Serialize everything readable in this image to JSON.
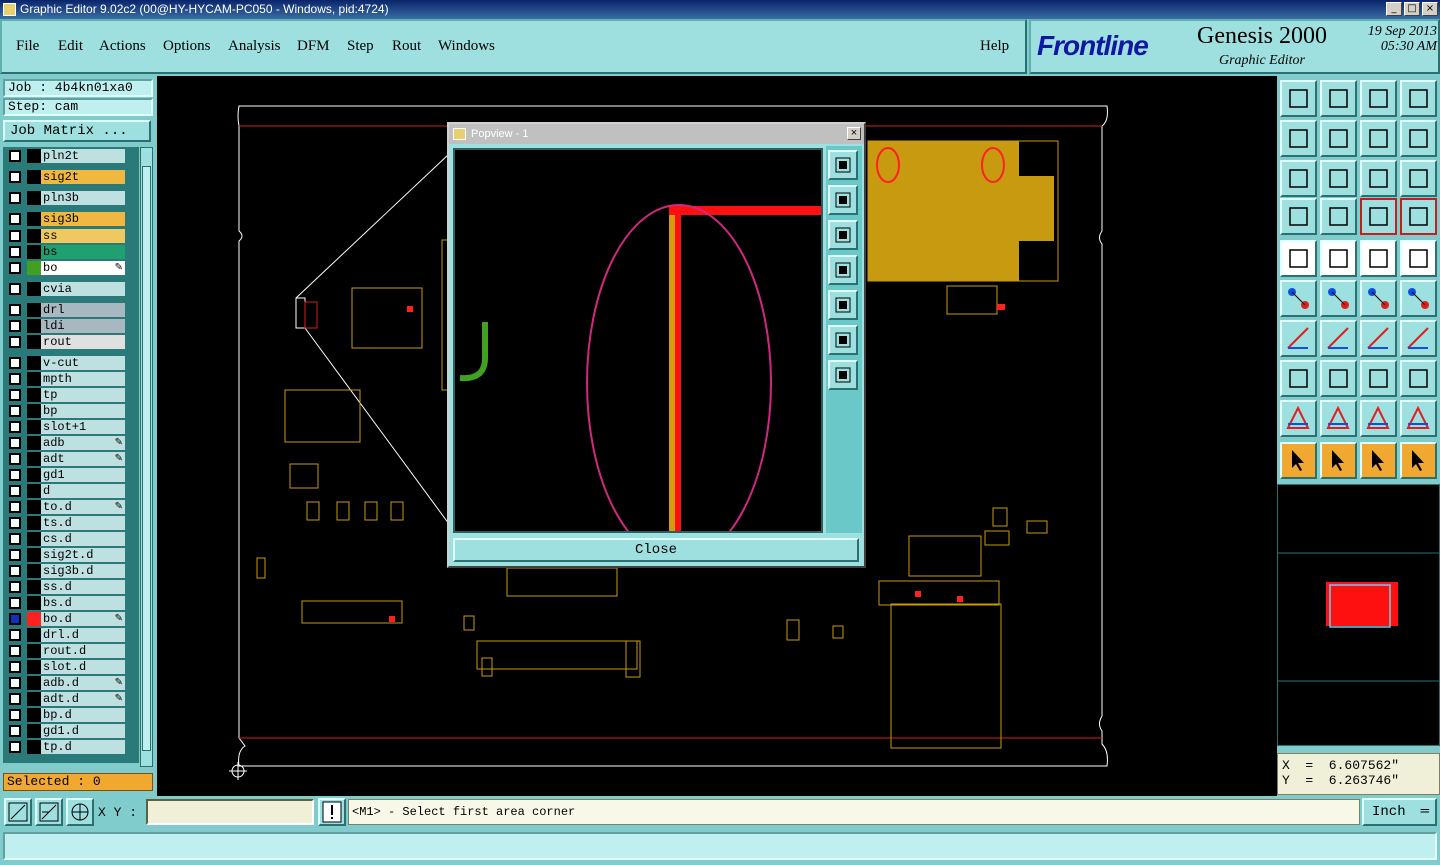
{
  "window": {
    "title": "Graphic Editor 9.02c2 (00@HY-HYCAM-PC050 - Windows, pid:4724)"
  },
  "menu": {
    "items": [
      "File",
      "Edit",
      "Actions",
      "Options",
      "Analysis",
      "DFM",
      "Step",
      "Rout",
      "Windows"
    ],
    "help": "Help"
  },
  "brand": {
    "logo": "Frontline",
    "product": "Genesis 2000",
    "subtitle": "Graphic Editor",
    "date": "19  Sep  2013",
    "time": "05:30  AM"
  },
  "job": {
    "job_label": "Job : 4b4kn01xa0",
    "step_label": "Step: cam",
    "matrix_button": "Job Matrix ..."
  },
  "layers": [
    {
      "name": "pln2t",
      "color": "#bfe0e0",
      "swatch": "#000000"
    },
    {
      "name": "sig2t",
      "color": "#f0b840",
      "swatch": "#000000"
    },
    {
      "name": "pln3b",
      "color": "#bfe0e0",
      "swatch": "#000000"
    },
    {
      "name": "sig3b",
      "color": "#f0b840",
      "swatch": "#000000"
    },
    {
      "name": "ss",
      "color": "#f0c860",
      "swatch": "#000000"
    },
    {
      "name": "bs",
      "color": "#20a070",
      "swatch": "#000000"
    },
    {
      "name": "bo",
      "color": "#ffffff",
      "swatch": "#40a020",
      "edit": true
    },
    {
      "name": "cvia",
      "color": "#bfe0e0",
      "swatch": "#000000"
    },
    {
      "name": "drl",
      "color": "#a8b8c0",
      "swatch": "#000000"
    },
    {
      "name": "ldi",
      "color": "#a8b8c0",
      "swatch": "#000000"
    },
    {
      "name": "rout",
      "color": "#e0e0e0",
      "swatch": "#000000"
    },
    {
      "name": "v-cut",
      "color": "#bfe0e0",
      "swatch": "#000000"
    },
    {
      "name": "mpth",
      "color": "#bfe0e0",
      "swatch": "#000000"
    },
    {
      "name": "tp",
      "color": "#bfe0e0",
      "swatch": "#000000"
    },
    {
      "name": "bp",
      "color": "#bfe0e0",
      "swatch": "#000000"
    },
    {
      "name": "slot+1",
      "color": "#bfe0e0",
      "swatch": "#000000"
    },
    {
      "name": "adb",
      "color": "#bfe0e0",
      "swatch": "#000000",
      "edit": true
    },
    {
      "name": "adt",
      "color": "#bfe0e0",
      "swatch": "#000000",
      "edit": true
    },
    {
      "name": "gd1",
      "color": "#bfe0e0",
      "swatch": "#000000"
    },
    {
      "name": "d",
      "color": "#bfe0e0",
      "swatch": "#000000"
    },
    {
      "name": "to.d",
      "color": "#bfe0e0",
      "swatch": "#000000",
      "edit": true
    },
    {
      "name": "ts.d",
      "color": "#bfe0e0",
      "swatch": "#000000"
    },
    {
      "name": "cs.d",
      "color": "#bfe0e0",
      "swatch": "#000000"
    },
    {
      "name": "sig2t.d",
      "color": "#bfe0e0",
      "swatch": "#000000"
    },
    {
      "name": "sig3b.d",
      "color": "#bfe0e0",
      "swatch": "#000000"
    },
    {
      "name": "ss.d",
      "color": "#bfe0e0",
      "swatch": "#000000"
    },
    {
      "name": "bs.d",
      "color": "#bfe0e0",
      "swatch": "#000000"
    },
    {
      "name": "bo.d",
      "color": "#bfe0e0",
      "swatch": "#ff2020",
      "edit": true,
      "active": true
    },
    {
      "name": "drl.d",
      "color": "#bfe0e0",
      "swatch": "#000000"
    },
    {
      "name": "rout.d",
      "color": "#bfe0e0",
      "swatch": "#000000"
    },
    {
      "name": "slot.d",
      "color": "#bfe0e0",
      "swatch": "#000000"
    },
    {
      "name": "adb.d",
      "color": "#bfe0e0",
      "swatch": "#000000",
      "edit": true
    },
    {
      "name": "adt.d",
      "color": "#bfe0e0",
      "swatch": "#000000",
      "edit": true
    },
    {
      "name": "bp.d",
      "color": "#bfe0e0",
      "swatch": "#000000"
    },
    {
      "name": "gd1.d",
      "color": "#bfe0e0",
      "swatch": "#000000"
    },
    {
      "name": "tp.d",
      "color": "#bfe0e0",
      "swatch": "#000000"
    }
  ],
  "selected": "Selected : 0",
  "popview": {
    "title": "Popview - 1",
    "close_label": "Close"
  },
  "coords": {
    "x": "X  =  6.607562\"",
    "y": "Y  =  6.263746\""
  },
  "bottom": {
    "xy_label": "X Y :",
    "message": "<M1> - Select first area corner",
    "units": "Inch"
  },
  "icons": [
    "grid-icon",
    "measure-icon",
    "snap-icon",
    "alert-icon"
  ],
  "colors": {
    "accent_orange": "#f0a830",
    "panel": "#80cccc",
    "board_gold": "#c89a10",
    "trace_red": "#ff1010"
  }
}
